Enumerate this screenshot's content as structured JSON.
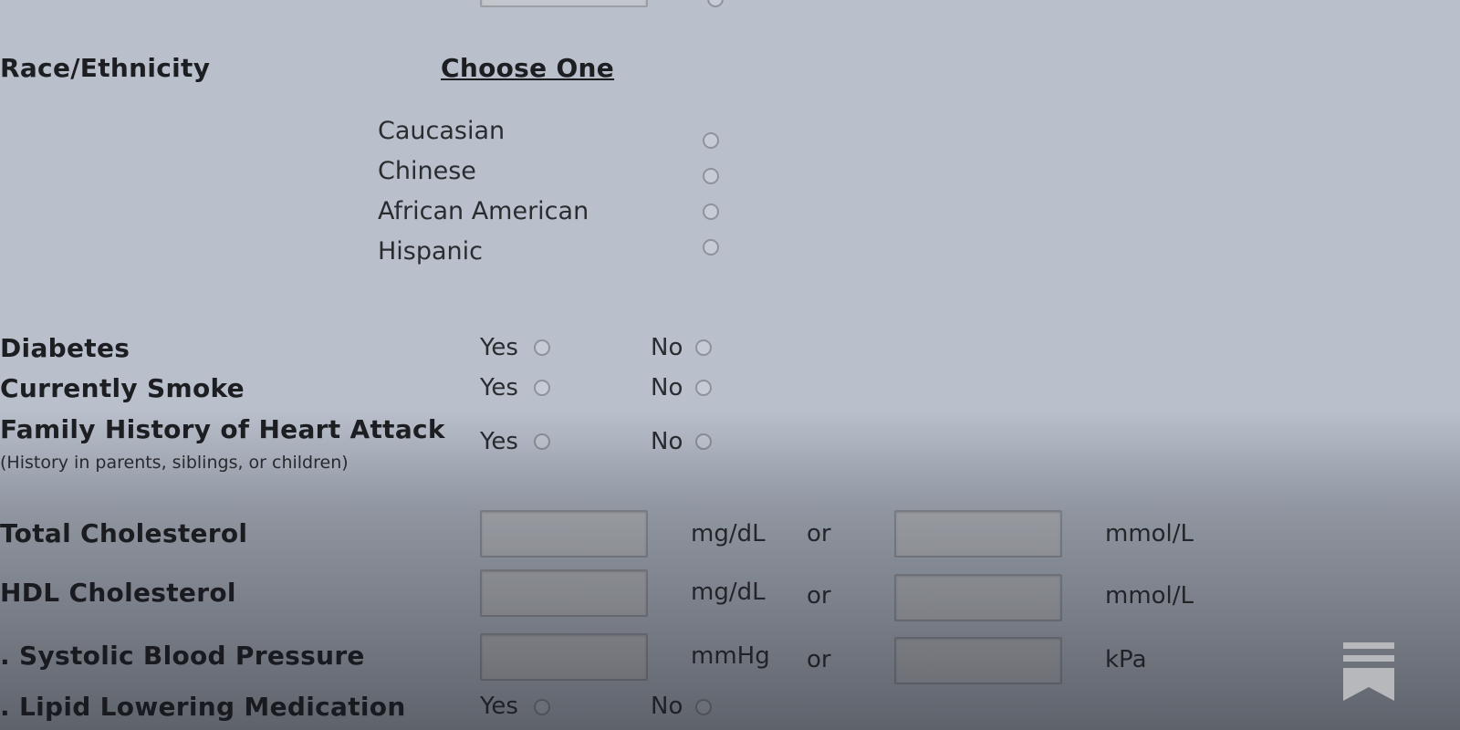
{
  "race": {
    "label": "Race/Ethnicity",
    "choose_label": "Choose One",
    "options": [
      "Caucasian",
      "Chinese",
      "African American",
      "Hispanic"
    ]
  },
  "yes_no": {
    "yes": "Yes",
    "no": "No",
    "rows": [
      {
        "label": "Diabetes"
      },
      {
        "label": "Currently Smoke"
      },
      {
        "label": "Family History of Heart Attack",
        "sublabel": "(History in parents, siblings, or children)"
      }
    ]
  },
  "measurements": [
    {
      "label": "Total Cholesterol",
      "unit1": "mg/dL",
      "or": "or",
      "unit2": "mmol/L",
      "value1": "",
      "value2": ""
    },
    {
      "label": "HDL Cholesterol",
      "unit1": "mg/dL",
      "or": "or",
      "unit2": "mmol/L",
      "value1": "",
      "value2": ""
    },
    {
      "label": ". Systolic Blood Pressure",
      "unit1": "mmHg",
      "or": "or",
      "unit2": "kPa",
      "value1": "",
      "value2": ""
    }
  ],
  "lipid": {
    "label": ". Lipid Lowering Medication",
    "yes": "Yes",
    "no": "No"
  },
  "logo_icon": "substack-bookmark-icon"
}
